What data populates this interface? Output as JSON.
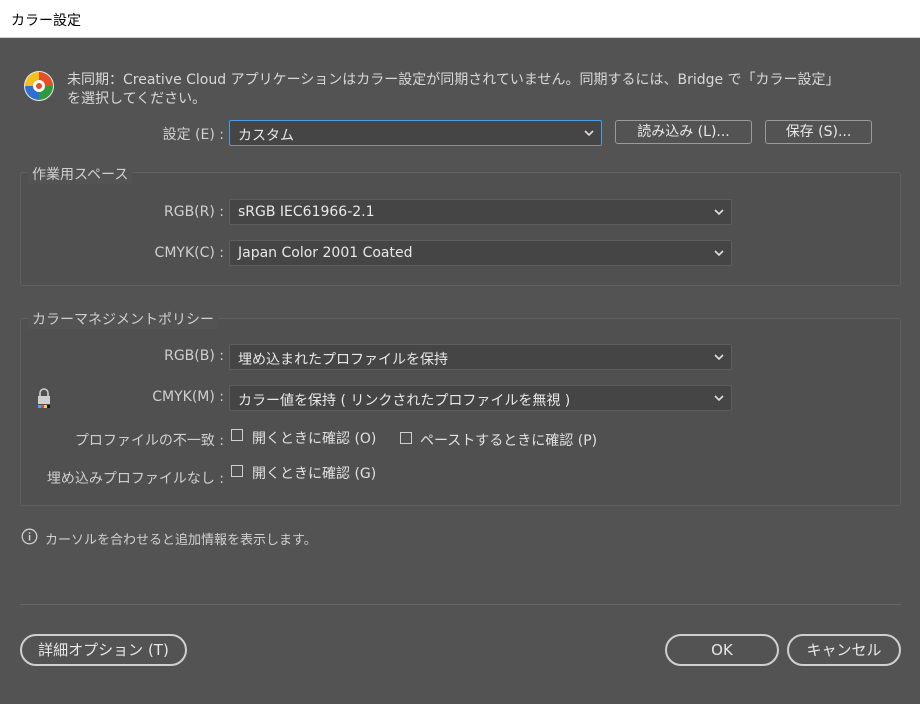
{
  "window": {
    "title": "カラー設定"
  },
  "sync_notice": {
    "line1": "未同期：Creative Cloud アプリケーションはカラー設定が同期されていません。同期するには、Bridge で「カラー設定」",
    "line2": "を選択してください。"
  },
  "settings": {
    "label": "設定 (E) :",
    "value": "カスタム",
    "load_button": "読み込み (L)...",
    "save_button": "保存 (S)..."
  },
  "working_spaces": {
    "title": "作業用スペース",
    "rgb_label": "RGB(R) :",
    "rgb_value": "sRGB IEC61966-2.1",
    "cmyk_label": "CMYK(C) :",
    "cmyk_value": "Japan Color 2001 Coated"
  },
  "policies": {
    "title": "カラーマネジメントポリシー",
    "rgb_label": "RGB(B) :",
    "rgb_value": "埋め込まれたプロファイルを保持",
    "cmyk_label": "CMYK(M) :",
    "cmyk_value": "カラー値を保持 ( リンクされたプロファイルを無視 )",
    "mismatch_label": "プロファイルの不一致 :",
    "mismatch_open": "開くときに確認 (O)",
    "mismatch_paste": "ペーストするときに確認 (P)",
    "missing_label": "埋め込みプロファイルなし :",
    "missing_open": "開くときに確認 (G)"
  },
  "info": {
    "text": "カーソルを合わせると追加情報を表示します。"
  },
  "footer": {
    "advanced_button": "詳細オプション (T)",
    "ok_button": "OK",
    "cancel_button": "キャンセル"
  },
  "colors": {
    "background": "#535353",
    "field": "#454545",
    "focus_border": "#4a9be8",
    "text": "#d6d6d6"
  }
}
